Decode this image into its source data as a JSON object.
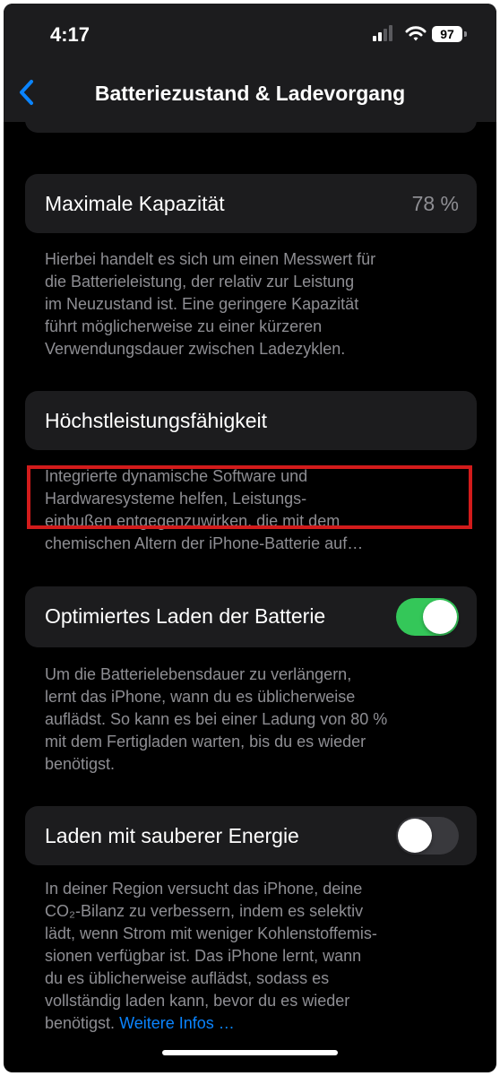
{
  "status_bar": {
    "time": "4:17",
    "battery_level": "97",
    "icons": [
      "cellular-signal-icon",
      "wifi-icon",
      "battery-icon"
    ]
  },
  "nav": {
    "back_icon": "chevron-left-icon",
    "title": "Batteriezustand & Ladevorgang"
  },
  "sections": {
    "capacity": {
      "label": "Maximale Kapazität",
      "value": "78 %",
      "footer_lines": [
        "Hierbei handelt es sich um einen Messwert für",
        "die Batterieleistung, der relativ zur Leistung",
        "im Neuzustand ist. Eine geringere Kapazität",
        "führt möglicherweise zu einer kürzeren",
        "Verwendungsdauer zwischen Ladezyklen."
      ]
    },
    "peak_performance": {
      "label": "Höchstleistungsfähigkeit",
      "footer_lines": [
        "Integrierte dynamische Software und",
        "Hardwaresysteme helfen, Leistungs-",
        "einbußen entgegenzuwirken, die mit dem",
        "chemischen Altern der iPhone-Batterie auf…"
      ]
    },
    "optimized_charging": {
      "label": "Optimiertes Laden der Batterie",
      "toggle_on": true,
      "footer_lines": [
        "Um die Batterielebensdauer zu verlängern,",
        "lernt das iPhone, wann du es üblicherweise",
        "auflädst. So kann es bei einer Ladung von 80 %",
        "mit dem Fertigladen warten, bis du es wieder",
        "benötigst."
      ]
    },
    "clean_energy": {
      "label": "Laden mit sauberer Energie",
      "toggle_on": false,
      "footer_lines": [
        "In deiner Region versucht das iPhone, deine",
        "CO₂-Bilanz zu verbessern, indem es selektiv",
        "lädt, wenn Strom mit weniger Kohlenstoffemis-",
        "sionen verfügbar ist. Das iPhone lernt, wann",
        "du es üblicherweise auflädst, sodass es",
        "vollständig laden kann, bevor du es wieder"
      ],
      "footer_last_line": "benötigst.",
      "footer_link": "Weitere Infos …"
    }
  },
  "colors": {
    "background": "#000000",
    "card": "#1c1c1e",
    "text_primary": "#ffffff",
    "text_secondary": "#8e8e93",
    "accent": "#0a84ff",
    "toggle_on": "#34c759",
    "toggle_off": "#39393d",
    "highlight_border": "#d21b1b"
  }
}
